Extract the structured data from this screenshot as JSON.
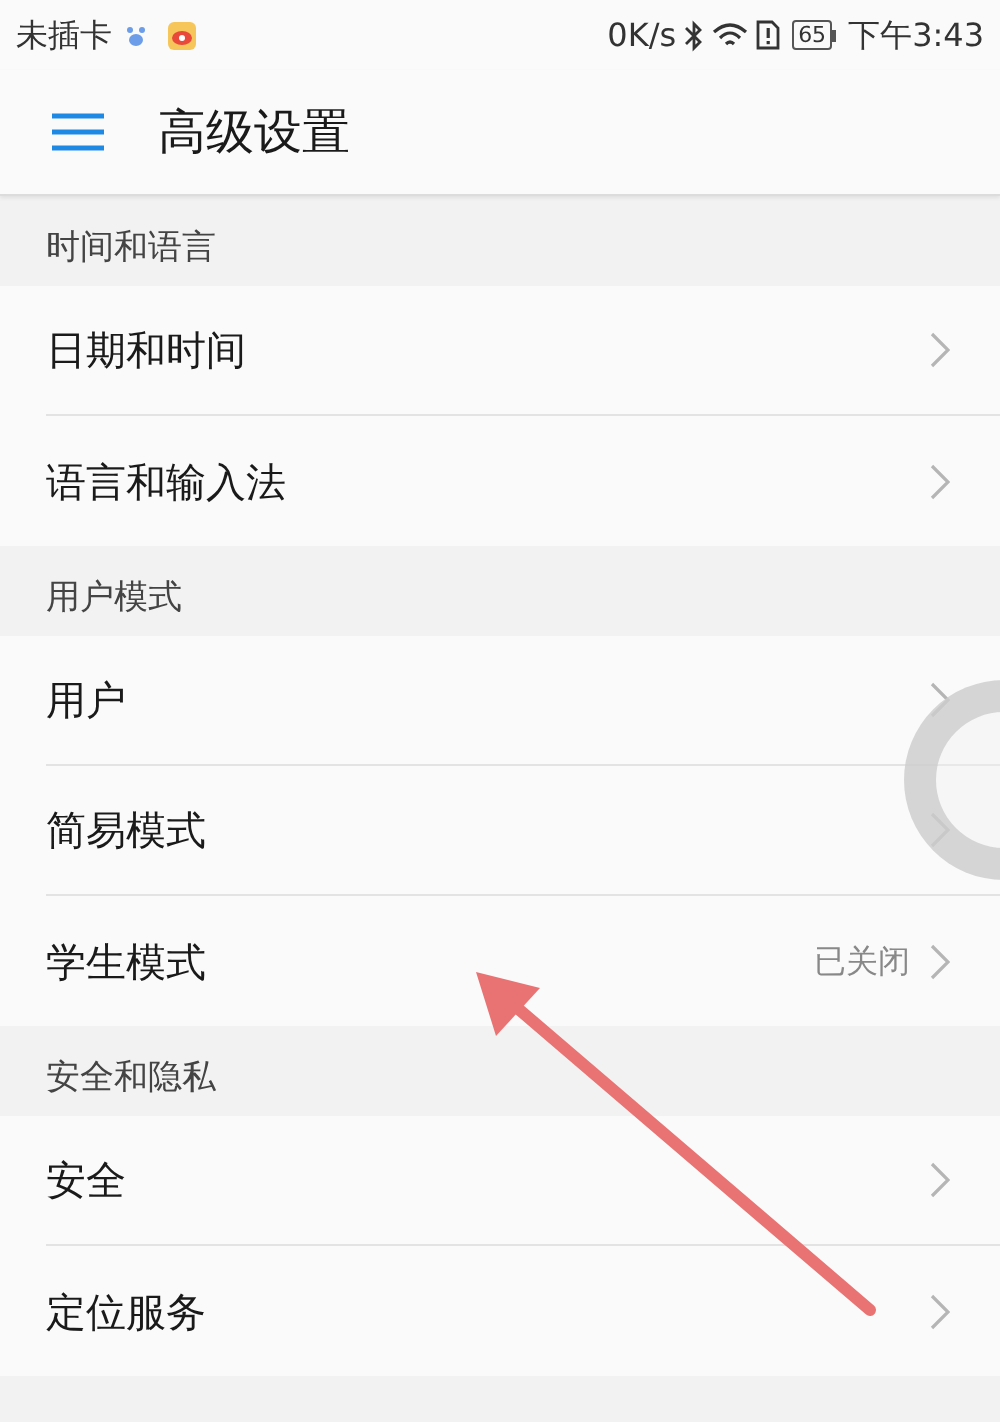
{
  "status_bar": {
    "carrier": "未插卡",
    "speed": "0K/s",
    "battery": "65",
    "time": "下午3:43"
  },
  "app_bar": {
    "title": "高级设置"
  },
  "sections": [
    {
      "title": "时间和语言",
      "items": [
        {
          "label": "日期和时间"
        },
        {
          "label": "语言和输入法"
        }
      ]
    },
    {
      "title": "用户模式",
      "items": [
        {
          "label": "用户"
        },
        {
          "label": "简易模式"
        },
        {
          "label": "学生模式",
          "value": "已关闭"
        }
      ]
    },
    {
      "title": "安全和隐私",
      "items": [
        {
          "label": "安全"
        },
        {
          "label": "定位服务"
        }
      ]
    }
  ]
}
